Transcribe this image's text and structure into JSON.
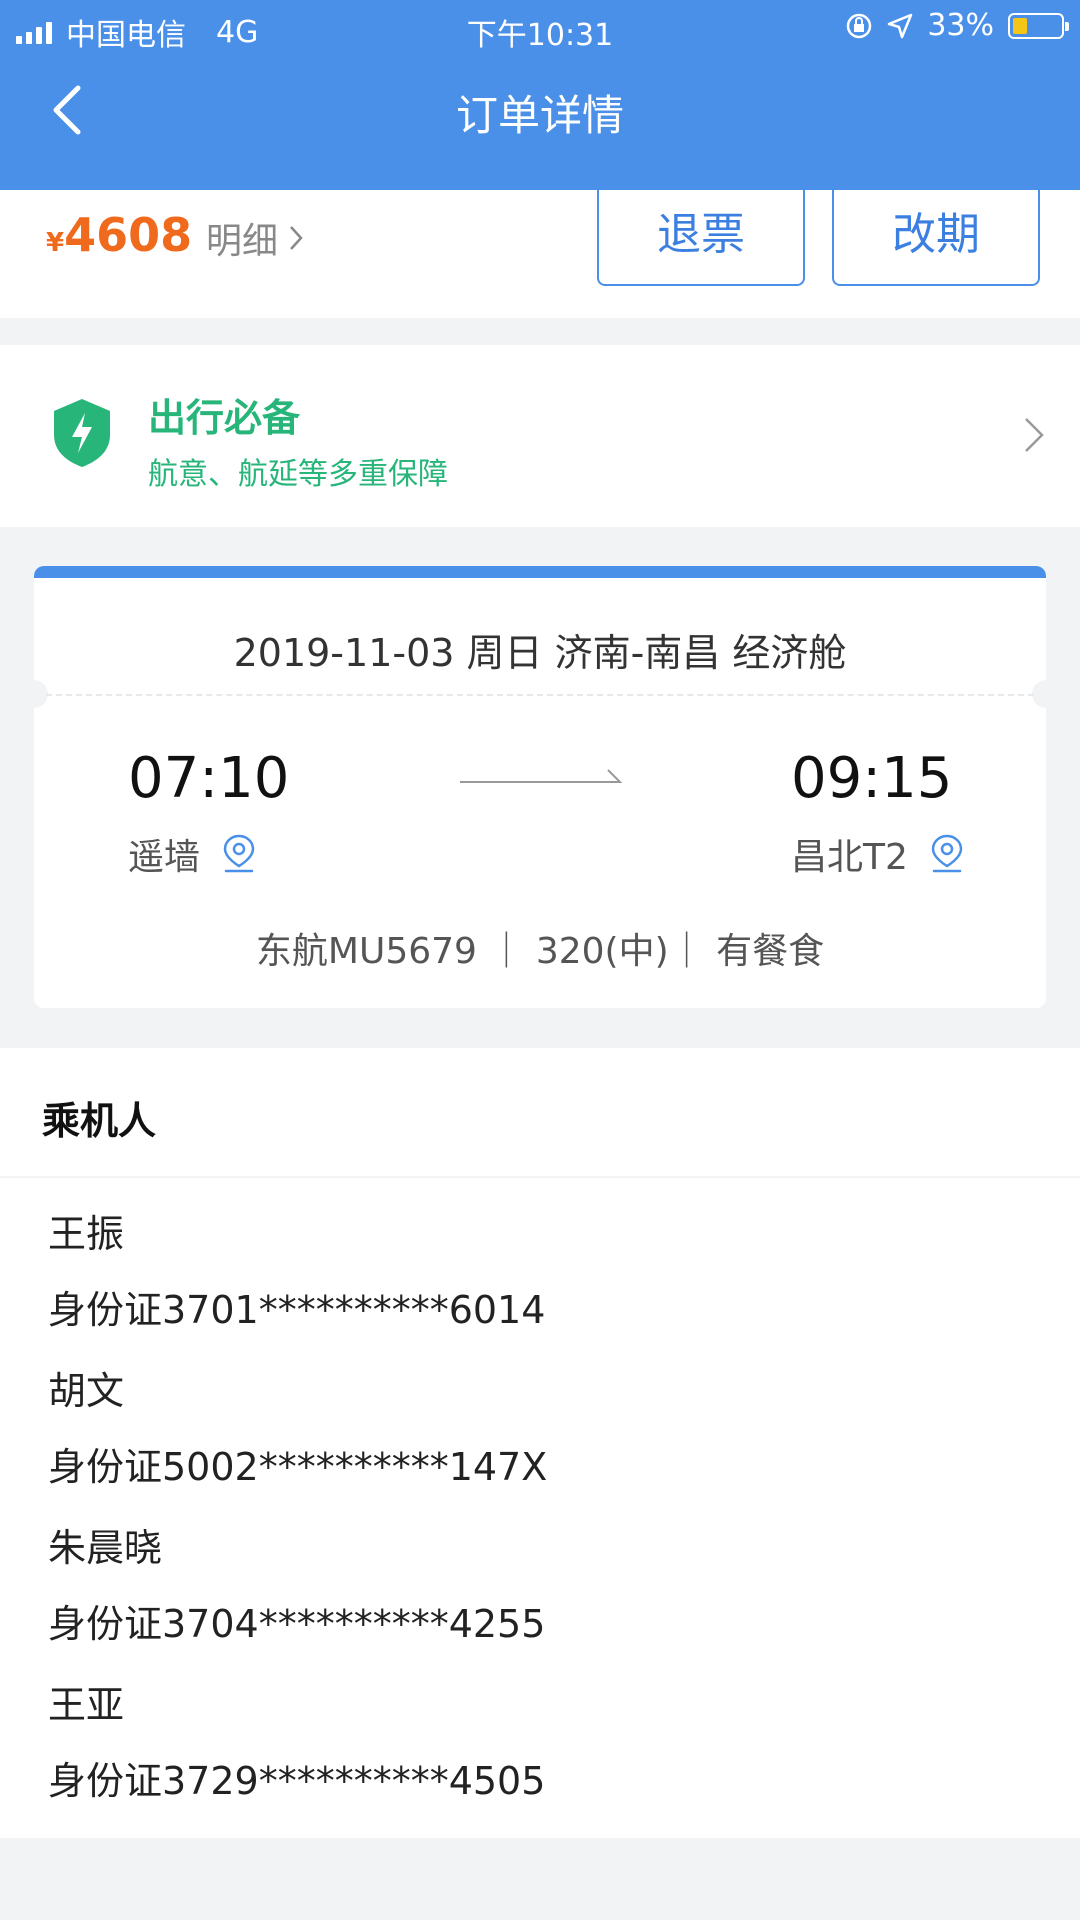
{
  "status_bar": {
    "carrier": "中国电信",
    "network": "4G",
    "time": "下午10:31",
    "battery": "33%"
  },
  "header": {
    "title": "订单详情"
  },
  "order": {
    "currency": "¥",
    "price": "4608",
    "detail_label": "明细",
    "refund_label": "退票",
    "change_label": "改期"
  },
  "essentials": {
    "title": "出行必备",
    "subtitle": "航意、航延等多重保障"
  },
  "flight": {
    "route": "2019-11-03 周日 济南-南昌 经济舱",
    "departure_time": "07:10",
    "departure_airport": "遥墙",
    "arrival_time": "09:15",
    "arrival_airport": "昌北T2",
    "info": "东航MU5679 ｜ 320(中)｜ 有餐食"
  },
  "passengers": {
    "header": "乘机人",
    "items": [
      {
        "name": "王振",
        "id": "身份证3701**********6014"
      },
      {
        "name": "胡文",
        "id": "身份证5002**********147X"
      },
      {
        "name": "朱晨晓",
        "id": "身份证3704**********4255"
      },
      {
        "name": "王亚",
        "id": "身份证3729**********4505"
      }
    ]
  },
  "colors": {
    "brand_blue": "#4a90e8",
    "price_orange": "#f06a1d",
    "safety_green": "#27b57a"
  }
}
